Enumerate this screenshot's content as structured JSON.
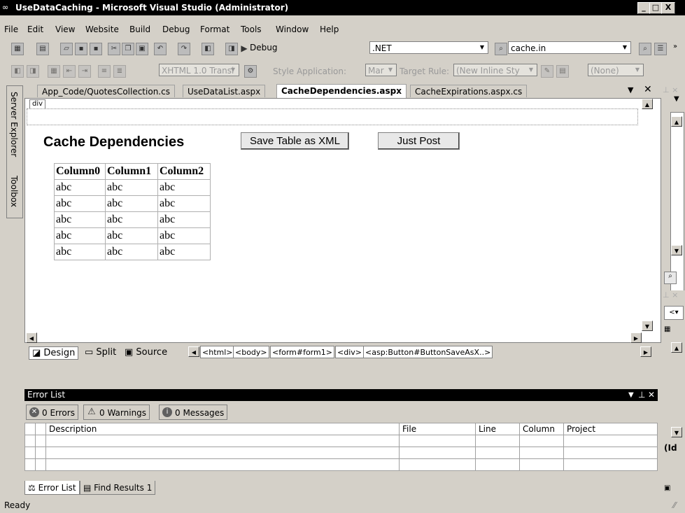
{
  "window": {
    "title": "UseDataCaching - Microsoft Visual Studio (Administrator)",
    "minimize": "_",
    "maximize": "□",
    "close": "X"
  },
  "menu": [
    "File",
    "Edit",
    "View",
    "Website",
    "Build",
    "Debug",
    "Format",
    "Tools",
    "Window",
    "Help"
  ],
  "toolbar1": {
    "config": "Debug",
    "platform": ".NET",
    "search": "cache.in"
  },
  "toolbar2": {
    "doctype": "XHTML 1.0 Transi",
    "style_app_label": "Style Application:",
    "style_app_value": "Mar",
    "target_rule_label": "Target Rule:",
    "target_rule_value": "(New Inline Sty",
    "none_value": "(None)"
  },
  "side_tabs": {
    "server_explorer": "Server Explorer",
    "toolbox": "Toolbox"
  },
  "tabs": [
    {
      "label": "App_Code/QuotesCollection.cs"
    },
    {
      "label": "UseDataList.aspx"
    },
    {
      "label": "CacheDependencies.aspx",
      "active": true
    },
    {
      "label": "CacheExpirations.aspx.cs"
    }
  ],
  "tab_controls": {
    "menu": "▼",
    "close": "✕"
  },
  "design": {
    "div_tag": "div",
    "heading": "Cache Dependencies",
    "save_button": "Save Table as XML",
    "post_button": "Just Post",
    "grid": {
      "headers": [
        "Column0",
        "Column1",
        "Column2"
      ],
      "rows": [
        [
          "abc",
          "abc",
          "abc"
        ],
        [
          "abc",
          "abc",
          "abc"
        ],
        [
          "abc",
          "abc",
          "abc"
        ],
        [
          "abc",
          "abc",
          "abc"
        ],
        [
          "abc",
          "abc",
          "abc"
        ]
      ]
    }
  },
  "viewbar": {
    "design": "Design",
    "split": "Split",
    "source": "Source",
    "crumbs": [
      "<html>",
      "<body>",
      "<form#form1>",
      "<div>",
      "<asp:Button#ButtonSaveAsX..>"
    ]
  },
  "error_list": {
    "title": "Error List",
    "errors": "0 Errors",
    "warnings": "0 Warnings",
    "messages": "0 Messages",
    "columns": [
      "Description",
      "File",
      "Line",
      "Column",
      "Project"
    ]
  },
  "bottom_tabs": [
    "Error List",
    "Find Results 1"
  ],
  "status": "Ready",
  "right_panel": {
    "label": "(Id"
  }
}
